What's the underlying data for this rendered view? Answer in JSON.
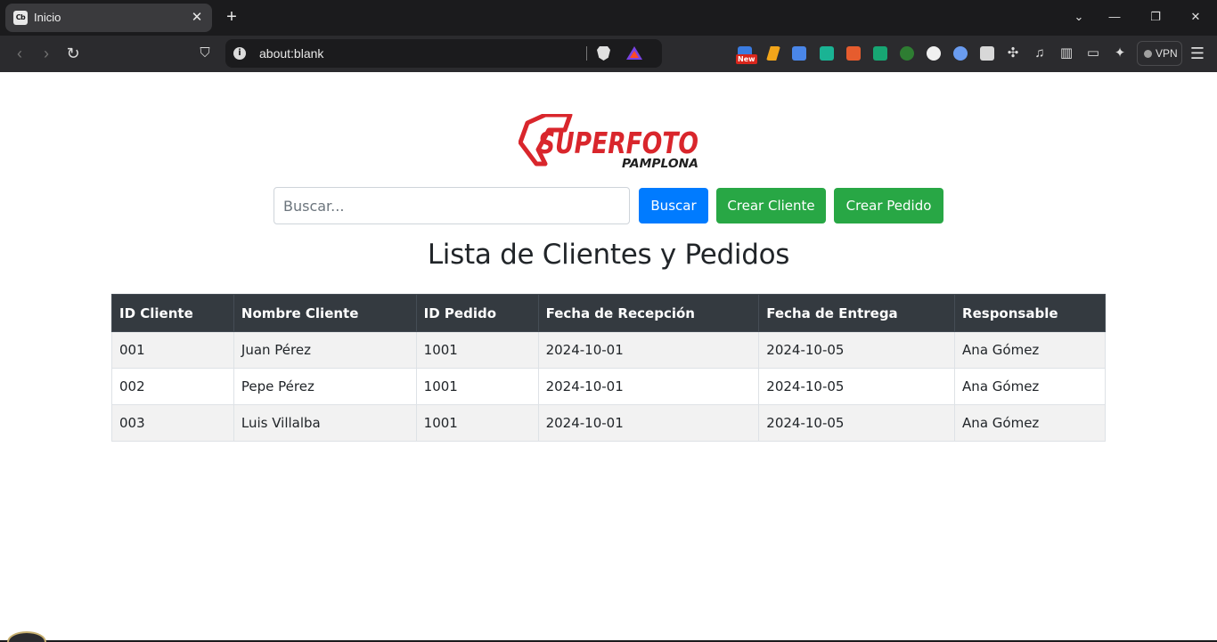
{
  "browser": {
    "tab": {
      "favicon": "Cb",
      "title": "Inicio"
    },
    "url": "about:blank",
    "vpn_label": "VPN",
    "extension_badge": "New"
  },
  "page": {
    "logo": {
      "main": "SUPERFOTO",
      "sub": "PAMPLONA",
      "brand_color": "#d9262c"
    },
    "search": {
      "placeholder": "Buscar..."
    },
    "buttons": {
      "search": "Buscar",
      "create_client": "Crear Cliente",
      "create_order": "Crear Pedido"
    },
    "title": "Lista de Clientes y Pedidos",
    "table": {
      "headers": [
        "ID Cliente",
        "Nombre Cliente",
        "ID Pedido",
        "Fecha de Recepción",
        "Fecha de Entrega",
        "Responsable"
      ],
      "rows": [
        [
          "001",
          "Juan Pérez",
          "1001",
          "2024-10-01",
          "2024-10-05",
          "Ana Gómez"
        ],
        [
          "002",
          "Pepe Pérez",
          "1001",
          "2024-10-01",
          "2024-10-05",
          "Ana Gómez"
        ],
        [
          "003",
          "Luis Villalba",
          "1001",
          "2024-10-01",
          "2024-10-05",
          "Ana Gómez"
        ]
      ]
    }
  },
  "colors": {
    "primary": "#007bff",
    "success": "#28a745",
    "table_header": "#343a40"
  }
}
